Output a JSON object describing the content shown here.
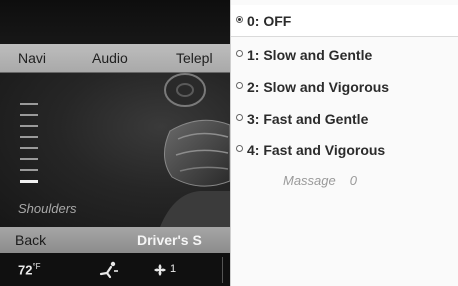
{
  "navbar": {
    "items": [
      {
        "label": "Navi"
      },
      {
        "label": "Audio"
      },
      {
        "label": "Telepl"
      }
    ]
  },
  "seat_panel": {
    "zone_label": "Shoulders",
    "level_bars_total": 8,
    "level_active_index": 7
  },
  "bottom_bar": {
    "back_label": "Back",
    "drivers_label": "Driver's S"
  },
  "status_bar": {
    "temperature": "72",
    "temperature_unit": "°F",
    "fan_level": "1"
  },
  "massage_menu": {
    "items": [
      {
        "label": "0: OFF",
        "selected": true
      },
      {
        "label": "1: Slow and Gentle",
        "selected": false
      },
      {
        "label": "2: Slow and Vigorous",
        "selected": false
      },
      {
        "label": "3: Fast and Gentle",
        "selected": false
      },
      {
        "label": "4: Fast and Vigorous",
        "selected": false
      }
    ],
    "footer_label": "Massage",
    "footer_value": "0"
  },
  "colors": {
    "menu_background": "#fafafa",
    "navbar": "#b5b5b5",
    "screen_dark": "#1a1a1a"
  }
}
